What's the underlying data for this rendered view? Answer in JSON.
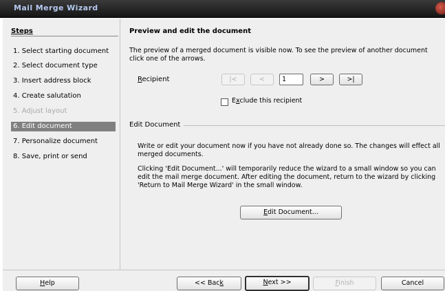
{
  "window": {
    "title": "Mail Merge Wizard"
  },
  "steps": {
    "title": "Steps",
    "items": [
      {
        "label": "1. Select starting document",
        "state": "normal"
      },
      {
        "label": "2. Select document type",
        "state": "normal"
      },
      {
        "label": "3. Insert address block",
        "state": "normal"
      },
      {
        "label": "4. Create salutation",
        "state": "normal"
      },
      {
        "label": "5. Adjust layout",
        "state": "disabled"
      },
      {
        "label": "6. Edit document",
        "state": "active"
      },
      {
        "label": "7. Personalize document",
        "state": "normal"
      },
      {
        "label": "8. Save, print or send",
        "state": "normal"
      }
    ]
  },
  "main": {
    "heading": "Preview and edit the document",
    "description": "The preview of a merged document is visible now. To see the preview of another document click one of the arrows.",
    "recipient": {
      "label": "Recipient",
      "first_label": "|<",
      "prev_label": "<",
      "value": "1",
      "next_label": ">",
      "last_label": ">|",
      "exclude_label": "Exclude this recipient",
      "exclude_checked": false
    },
    "edit_section": {
      "title": "Edit Document",
      "para1": "Write or edit your document now if you have not already done so. The changes will effect all merged documents.",
      "para2": "Clicking 'Edit Document...' will temporarily reduce the wizard to a small window so you can edit the mail merge document. After editing the document, return to the wizard by clicking 'Return to Mail Merge Wizard' in the small window.",
      "button_label": "Edit Document..."
    }
  },
  "footer": {
    "help": "Help",
    "back": "<< Back",
    "next": "Next >>",
    "finish": "Finish",
    "cancel": "Cancel"
  },
  "colors": {
    "titlebar": "#1e1e1e",
    "title_text": "#b4c8ee",
    "background": "#efefef",
    "active_step": "#808080",
    "disabled_text": "#a8a8a8"
  }
}
